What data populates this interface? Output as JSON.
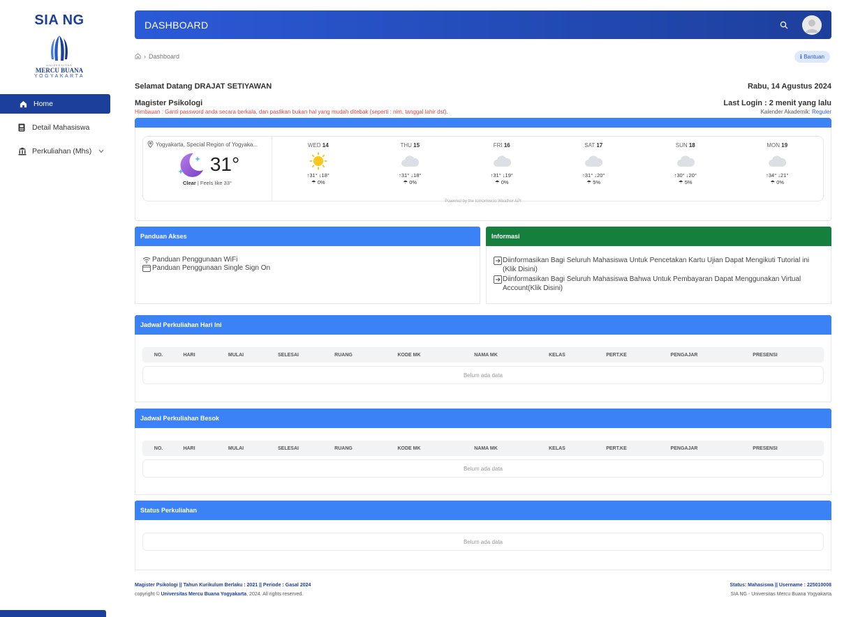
{
  "sidebar": {
    "brand": "SIA NG",
    "uni_small": "UNIVERSITAS",
    "uni_name": "MERCU BUANA",
    "uni_city": "YOGYAKARTA",
    "items": [
      {
        "label": "Home",
        "icon": "home-icon",
        "active": true
      },
      {
        "label": "Detail Mahasiswa",
        "icon": "id-card-icon",
        "active": false
      },
      {
        "label": "Perkuliahan (Mhs)",
        "icon": "bank-icon",
        "active": false
      }
    ]
  },
  "topbar": {
    "title": "DASHBOARD"
  },
  "breadcrumb": {
    "current": "Dashboard"
  },
  "help_label": "Bantuan",
  "welcome": "Selamat Datang DRAJAT SETIYAWAN",
  "date": "Rabu, 14 Agustus 2024",
  "program": "Magister Psikologi",
  "last_login": "Last Login : 2 menit yang lalu",
  "warning": "Himbauan : Ganti password anda secara berkala, dan pastikan bukan hal yang mudah ditebak (seperti : nim, tanggal lahir dst).",
  "kalender_label": "Kalender Akademik:",
  "kalender_value": "Reguler",
  "weather": {
    "location": "Yogyakarta, Special Region of Yogyaka...",
    "temp": "31°",
    "condition": "Clear",
    "feels": "| Feels like 33°",
    "powered": "Powered by the  tomorrow.io Weather API",
    "days": [
      {
        "dow": "WED",
        "num": "14",
        "hl": "↑31° ↓18°",
        "rain": "☂ 0%",
        "icon": "sun"
      },
      {
        "dow": "THU",
        "num": "15",
        "hl": "↑31° ↓18°",
        "rain": "☂ 0%",
        "icon": "cloud"
      },
      {
        "dow": "FRI",
        "num": "16",
        "hl": "↑31° ↓19°",
        "rain": "☂ 0%",
        "icon": "cloud"
      },
      {
        "dow": "SAT",
        "num": "17",
        "hl": "↑31° ↓20°",
        "rain": "☂ 5%",
        "icon": "cloud"
      },
      {
        "dow": "SUN",
        "num": "18",
        "hl": "↑30° ↓20°",
        "rain": "☂ 5%",
        "icon": "cloud"
      },
      {
        "dow": "MON",
        "num": "19",
        "hl": "↑34° ↓21°",
        "rain": "☂ 0%",
        "icon": "cloud"
      }
    ]
  },
  "panduan": {
    "title": "Panduan Akses",
    "items": [
      "Panduan Penggunaan WiFi",
      "Panduan Penggunaan Single Sign On"
    ]
  },
  "informasi": {
    "title": "Informasi",
    "items": [
      "Diinformasikan Bagi Seluruh Mahasiswa Untuk Pencetakan Kartu Ujian Dapat Mengikuti Tutorial ini (Klik Disini)",
      "Diinformasikan Bagi Seluruh Mahasiswa Bahwa Untuk Pembayaran Dapat Menggunakan Virtual Account(Klik Disini)"
    ]
  },
  "table_columns": [
    "NO.",
    "HARI",
    "MULAI",
    "SELESAI",
    "RUANG",
    "KODE MK",
    "NAMA MK",
    "KELAS",
    "PERT.KE",
    "PENGAJAR",
    "PRESENSI"
  ],
  "jadwal_hari_ini": {
    "title": "Jadwal Perkuliahan Hari Ini",
    "empty": "Belum ada data"
  },
  "jadwal_besok": {
    "title": "Jadwal Perkuliahan Besok",
    "empty": "Belum ada data"
  },
  "status": {
    "title": "Status Perkuliahan",
    "empty": "Belum ada data"
  },
  "footer": {
    "left_line1": "Magister Psikologi || Tahun Kurikulum Berlaku : 2021 || Periode : Gasal 2024",
    "left_line2_prefix": "copyright ©",
    "left_line2_link": "Universitas Mercu Buana Yogyakarta",
    "left_line2_suffix": ", 2024. All rights reserved.",
    "right_line1": "Status: Mahasiswa || Username : 225010008",
    "right_line2": "SIA NG - Universitas Mercu Buana Yogyakarta"
  }
}
